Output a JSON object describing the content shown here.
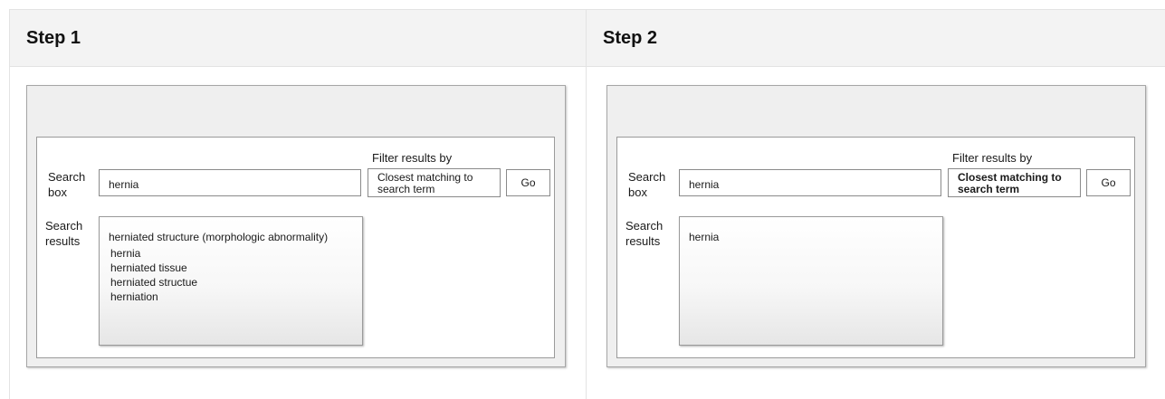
{
  "steps": [
    {
      "title": "Step 1",
      "search_box_label": [
        "Search",
        "box"
      ],
      "search_results_label": [
        "Search",
        "results"
      ],
      "search_value": "hernia",
      "filter_label": "Filter results by",
      "filter_value": [
        "Closest matching to",
        "search term"
      ],
      "filter_bold": false,
      "go_label": "Go",
      "results": [
        "herniated structure (morphologic abnormality)",
        "hernia",
        "herniated tissue",
        "herniated structue",
        "herniation"
      ]
    },
    {
      "title": "Step 2",
      "search_box_label": [
        "Search",
        "box"
      ],
      "search_results_label": [
        "Search",
        "results"
      ],
      "search_value": "hernia",
      "filter_label": "Filter results by",
      "filter_value": [
        "Closest matching to",
        "search term"
      ],
      "filter_bold": true,
      "go_label": "Go",
      "results": [
        "hernia"
      ]
    }
  ]
}
